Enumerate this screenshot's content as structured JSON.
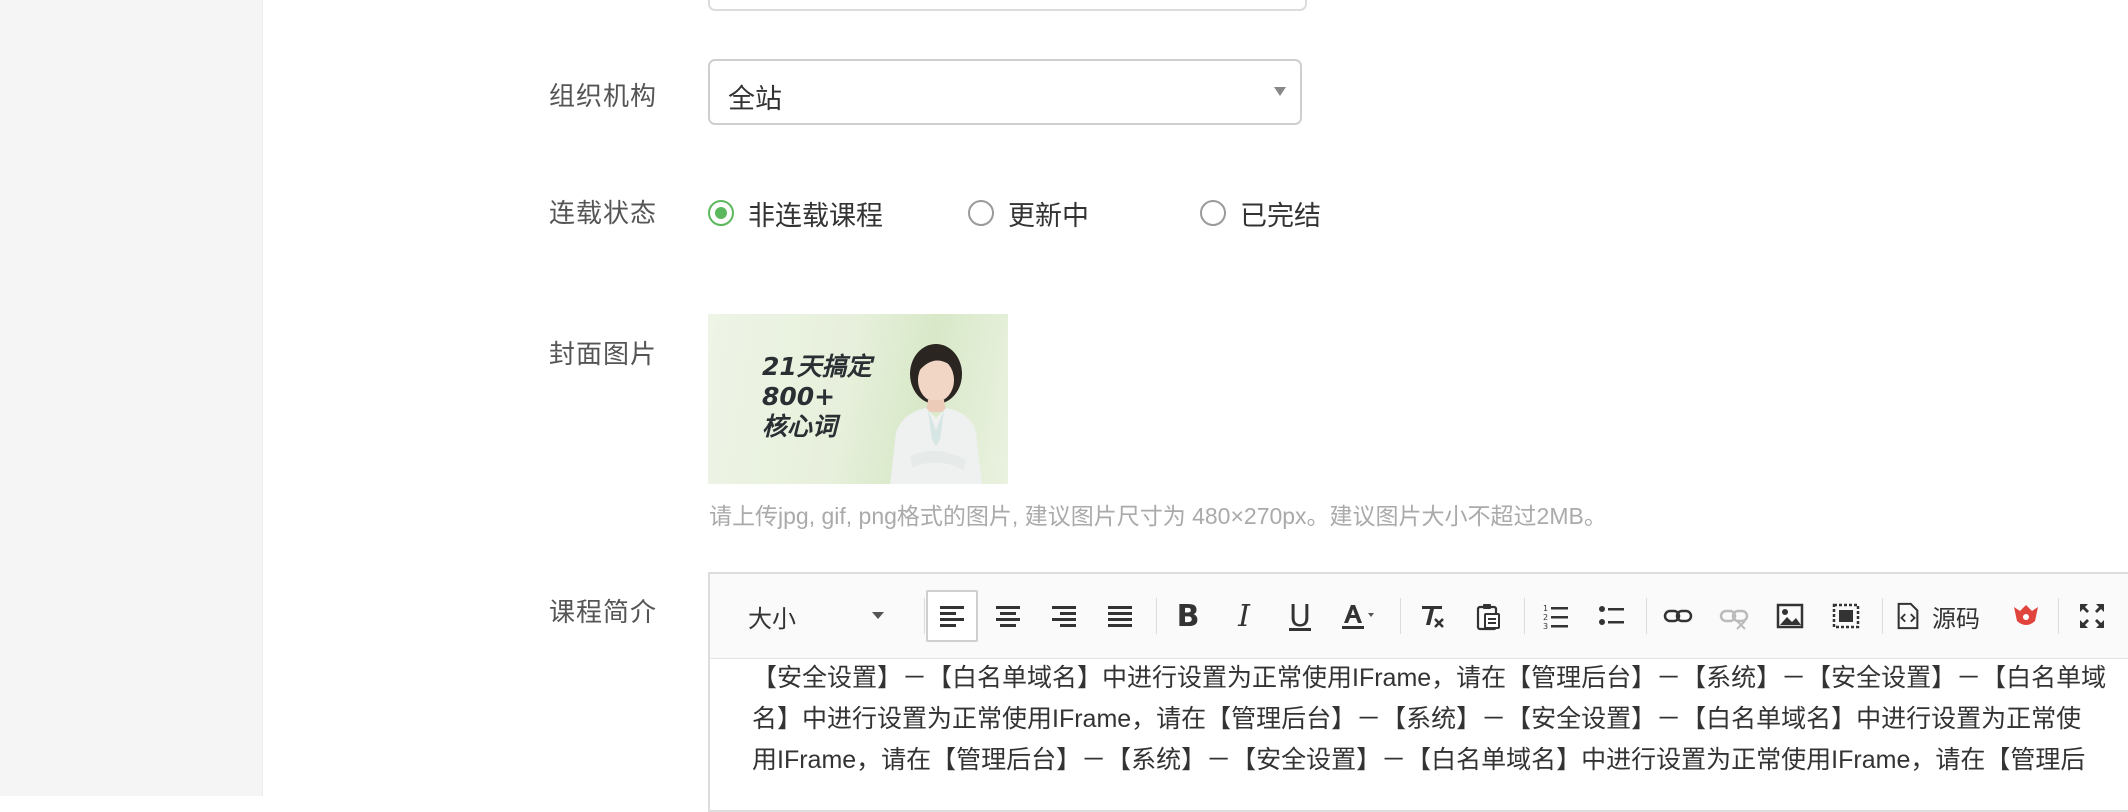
{
  "form": {
    "org_label": "组织机构",
    "org_value": "全站",
    "status_label": "连载状态",
    "status_options": [
      "非连载课程",
      "更新中",
      "已完结"
    ],
    "status_selected": "非连载课程",
    "cover_label": "封面图片",
    "cover_text": [
      "21天搞定",
      "800+",
      "核心词"
    ],
    "cover_hint": "请上传jpg, gif, png格式的图片, 建议图片尺寸为 480×270px。建议图片大小不超过2MB。",
    "intro_label": "课程简介"
  },
  "editor": {
    "font_size_label": "大小",
    "source_label": "源码",
    "content_lines": [
      "【安全设置】－【白名单域名】中进行设置为正常使用IFrame，请在【管理后台】－【系统】－【安全设置】－【白名单域",
      "名】中进行设置为正常使用IFrame，请在【管理后台】－【系统】－【安全设置】－【白名单域名】中进行设置为正常使",
      "用IFrame，请在【管理后台】－【系统】－【安全设置】－【白名单域名】中进行设置为正常使用IFrame，请在【管理后"
    ]
  },
  "colors": {
    "accent": "#5cb85c",
    "border": "#dcdcdc",
    "hint": "#aaaaaa",
    "label": "#555555"
  }
}
